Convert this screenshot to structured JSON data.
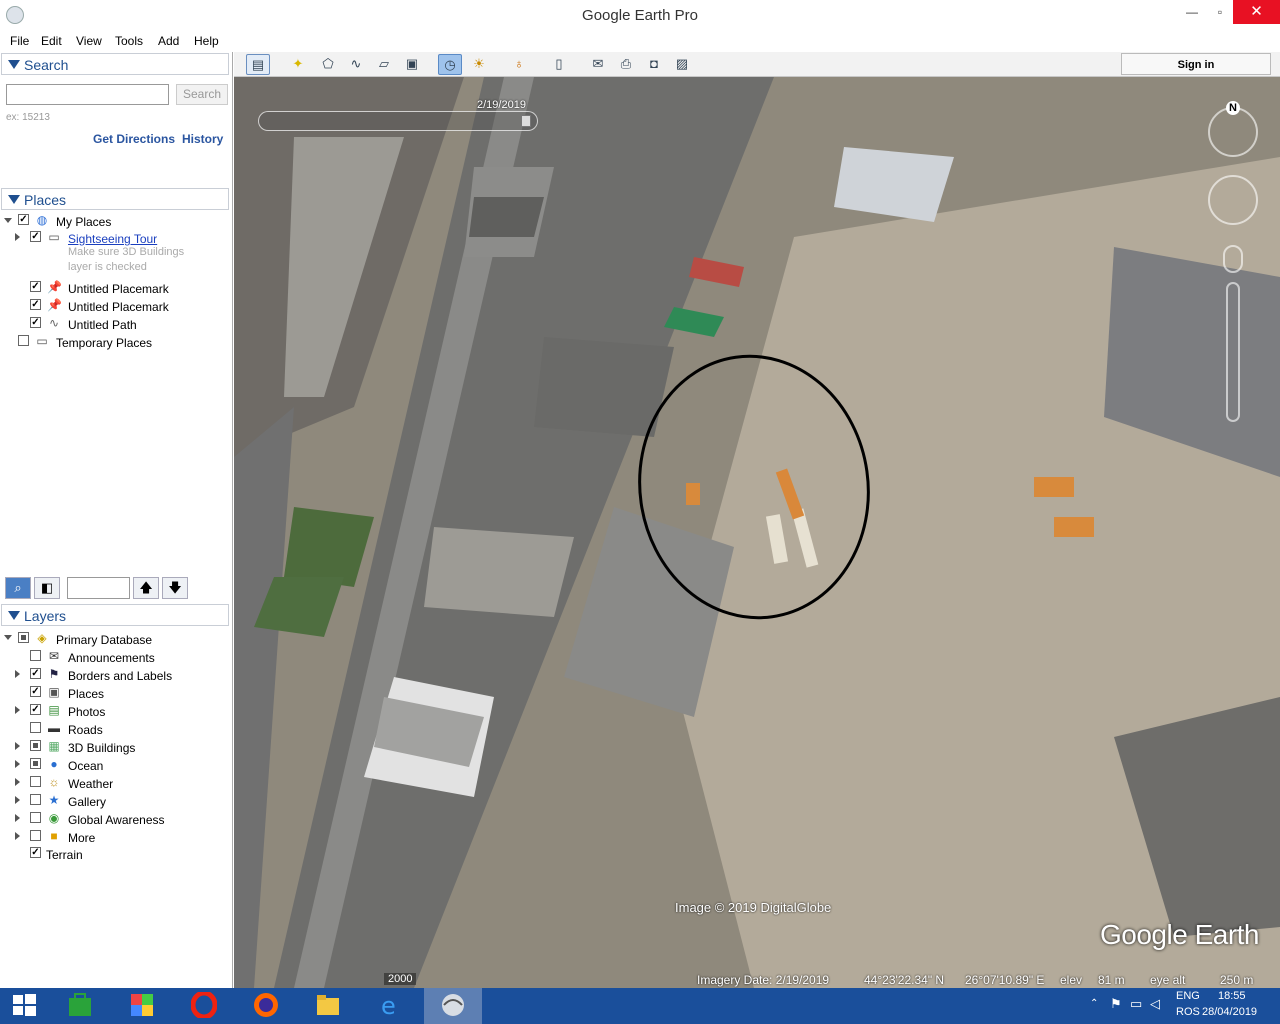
{
  "window": {
    "title": "Google Earth Pro",
    "controls": {
      "minimize": "—",
      "maximize": "▫",
      "close": "✕"
    }
  },
  "menu": [
    "File",
    "Edit",
    "View",
    "Tools",
    "Add",
    "Help"
  ],
  "search": {
    "header": "Search",
    "input_value": "",
    "button_label": "Search",
    "hint": "ex: 15213",
    "get_directions": "Get Directions",
    "history": "History"
  },
  "places": {
    "header": "Places",
    "items": [
      {
        "label": "My Places",
        "checked": true,
        "icon": "globe-icon"
      },
      {
        "label": "Sightseeing Tour",
        "checked": true,
        "icon": "folder-icon",
        "note": [
          "Make sure 3D Buildings",
          "layer is checked"
        ]
      },
      {
        "label": "Untitled Placemark",
        "checked": true,
        "icon": "placemark-icon"
      },
      {
        "label": "Untitled Placemark",
        "checked": true,
        "icon": "placemark-icon"
      },
      {
        "label": "Untitled Path",
        "checked": true,
        "icon": "path-icon"
      },
      {
        "label": "Temporary Places",
        "checked": false,
        "icon": "folder-icon"
      }
    ]
  },
  "layers": {
    "header": "Layers",
    "items": [
      {
        "label": "Primary Database",
        "icon": "database-icon"
      },
      {
        "label": "Announcements",
        "icon": "envelope-icon"
      },
      {
        "label": "Borders and Labels",
        "icon": "flag-icon"
      },
      {
        "label": "Places",
        "icon": "places-layer-icon"
      },
      {
        "label": "Photos",
        "icon": "photo-icon"
      },
      {
        "label": "Roads",
        "icon": "road-icon"
      },
      {
        "label": "3D Buildings",
        "icon": "building-icon"
      },
      {
        "label": "Ocean",
        "icon": "ocean-icon"
      },
      {
        "label": "Weather",
        "icon": "weather-icon"
      },
      {
        "label": "Gallery",
        "icon": "gallery-icon"
      },
      {
        "label": "Global Awareness",
        "icon": "global-awareness-icon"
      },
      {
        "label": "More",
        "icon": "more-icon"
      },
      {
        "label": "Terrain",
        "icon": ""
      }
    ]
  },
  "toolbar": {
    "sign_in": "Sign in"
  },
  "map": {
    "time_slider_date": "2/19/2019",
    "credit": "Image © 2019 DigitalGlobe",
    "logo": "Google Earth",
    "compass_letter": "N",
    "history_year": "2000",
    "status": {
      "imagery_date": "Imagery Date: 2/19/2019",
      "lat": "44°23'22.34\" N",
      "lon": "26°07'10.89\" E",
      "elev_label": "elev",
      "elev": "81 m",
      "eye_label": "eye alt",
      "eye_alt": "250 m"
    }
  },
  "taskbar": {
    "lang_line1": "ENG",
    "lang_line2": "ROS",
    "time": "18:55",
    "date": "28/04/2019"
  }
}
